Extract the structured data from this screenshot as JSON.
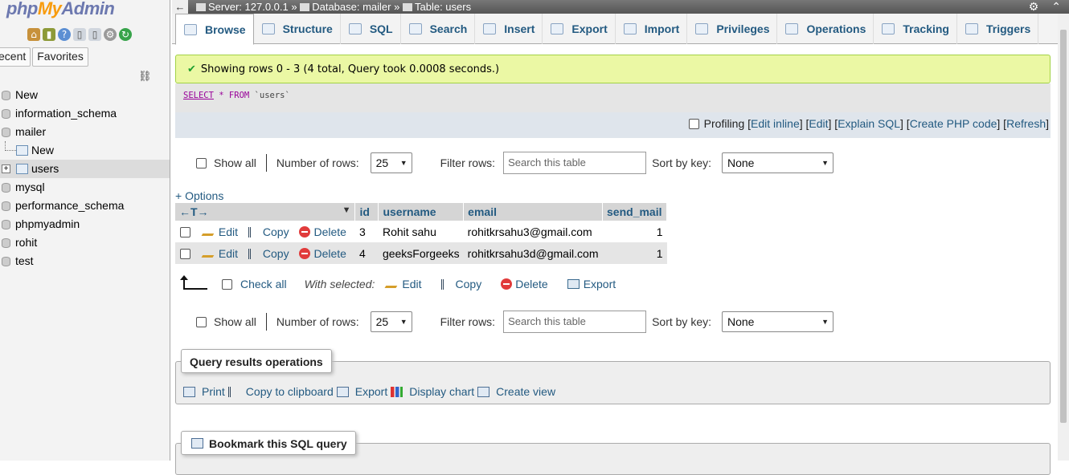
{
  "nav": {
    "logo_php": "php",
    "logo_my": "My",
    "logo_admin": "Admin",
    "tabs": [
      "ecent",
      "Favorites"
    ],
    "tree": [
      {
        "label": "New",
        "kind": "new"
      },
      {
        "label": "information_schema",
        "kind": "db"
      },
      {
        "label": "mailer",
        "kind": "db"
      },
      {
        "label": "New",
        "kind": "sub-new"
      },
      {
        "label": "users",
        "kind": "sub-table"
      },
      {
        "label": "mysql",
        "kind": "db"
      },
      {
        "label": "performance_schema",
        "kind": "db"
      },
      {
        "label": "phpmyadmin",
        "kind": "db"
      },
      {
        "label": "rohit",
        "kind": "db"
      },
      {
        "label": "test",
        "kind": "db"
      }
    ]
  },
  "topbar": {
    "server": "Server: 127.0.0.1",
    "database": "Database: mailer",
    "table": "Table: users",
    "sep": "»"
  },
  "tabs": [
    "Browse",
    "Structure",
    "SQL",
    "Search",
    "Insert",
    "Export",
    "Import",
    "Privileges",
    "Operations",
    "Tracking",
    "Triggers"
  ],
  "message": "Showing rows 0 - 3 (4 total, Query took 0.0008 seconds.)",
  "sql": {
    "select": "SELECT",
    "star": "*",
    "from": "FROM",
    "table": "`users`"
  },
  "sqlbar": {
    "profiling": "Profiling",
    "links": [
      "Edit inline",
      "Edit",
      "Explain SQL",
      "Create PHP code",
      "Refresh"
    ]
  },
  "navigation": {
    "show_all": "Show all",
    "num_rows_label": "Number of rows:",
    "num_rows_value": "25",
    "filter_label": "Filter rows:",
    "filter_placeholder": "Search this table",
    "sort_label": "Sort by key:",
    "sort_value": "None"
  },
  "options_link": "+ Options",
  "table": {
    "columns": [
      "id",
      "username",
      "email",
      "send_mail"
    ],
    "rows": [
      {
        "id": "3",
        "username": "Rohit sahu",
        "email": "rohitkrsahu3@gmail.com",
        "send_mail": "1"
      },
      {
        "id": "4",
        "username": "geeksForgeeks",
        "email": "rohitkrsahu3d@gmail.com",
        "send_mail": "1"
      }
    ],
    "actions": {
      "edit": "Edit",
      "copy": "Copy",
      "delete": "Delete"
    }
  },
  "with_selected": {
    "check_all": "Check all",
    "label": "With selected:",
    "edit": "Edit",
    "copy": "Copy",
    "delete": "Delete",
    "export": "Export"
  },
  "query_ops": {
    "legend": "Query results operations",
    "print": "Print",
    "copy": "Copy to clipboard",
    "export": "Export",
    "chart": "Display chart",
    "view": "Create view"
  },
  "bookmark": {
    "legend": "Bookmark this SQL query"
  }
}
